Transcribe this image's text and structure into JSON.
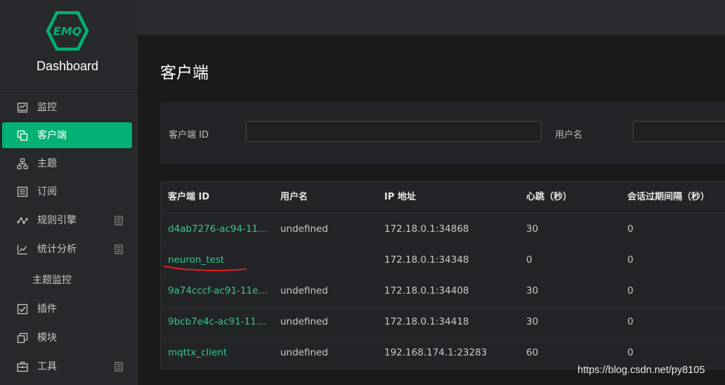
{
  "brand": {
    "logo_text": "EMQ",
    "title": "Dashboard"
  },
  "sidebar": {
    "items": [
      {
        "label": "监控",
        "icon": "monitor-icon"
      },
      {
        "label": "客户端",
        "icon": "clients-icon",
        "active": true
      },
      {
        "label": "主题",
        "icon": "topics-icon"
      },
      {
        "label": "订阅",
        "icon": "subscriptions-icon"
      },
      {
        "label": "规则引擎",
        "icon": "rule-engine-icon",
        "expandable": true
      },
      {
        "label": "统计分析",
        "icon": "analysis-icon",
        "expandable": true
      }
    ],
    "submenu_topic_metrics": "主题监控",
    "items2": [
      {
        "label": "插件",
        "icon": "plugins-icon"
      },
      {
        "label": "模块",
        "icon": "modules-icon"
      },
      {
        "label": "工具",
        "icon": "tools-icon",
        "expandable": true
      }
    ]
  },
  "page": {
    "title": "客户端"
  },
  "search": {
    "client_id_label": "客户端 ID",
    "client_id_value": "",
    "username_label": "用户名",
    "username_value": ""
  },
  "table": {
    "headers": [
      "客户端 ID",
      "用户名",
      "IP 地址",
      "心跳（秒）",
      "会话过期间隔（秒）"
    ],
    "rows": [
      {
        "client_id": "d4ab7276-ac94-11…",
        "username": "undefined",
        "ip": "172.18.0.1:34868",
        "keepalive": "30",
        "expiry": "0"
      },
      {
        "client_id": "neuron_test",
        "username": "",
        "ip": "172.18.0.1:34348",
        "keepalive": "0",
        "expiry": "0"
      },
      {
        "client_id": "9a74cccf-ac91-11e…",
        "username": "undefined",
        "ip": "172.18.0.1:34408",
        "keepalive": "30",
        "expiry": "0"
      },
      {
        "client_id": "9bcb7e4c-ac91-11e…",
        "username": "undefined",
        "ip": "172.18.0.1:34418",
        "keepalive": "30",
        "expiry": "0"
      },
      {
        "client_id": "mqttx_client",
        "username": "undefined",
        "ip": "192.168.174.1:23283",
        "keepalive": "60",
        "expiry": "0"
      }
    ]
  },
  "watermark": "https://blog.csdn.net/py8105",
  "colors": {
    "accent": "#00b173",
    "link": "#35c48d",
    "annotation": "#e02020"
  }
}
